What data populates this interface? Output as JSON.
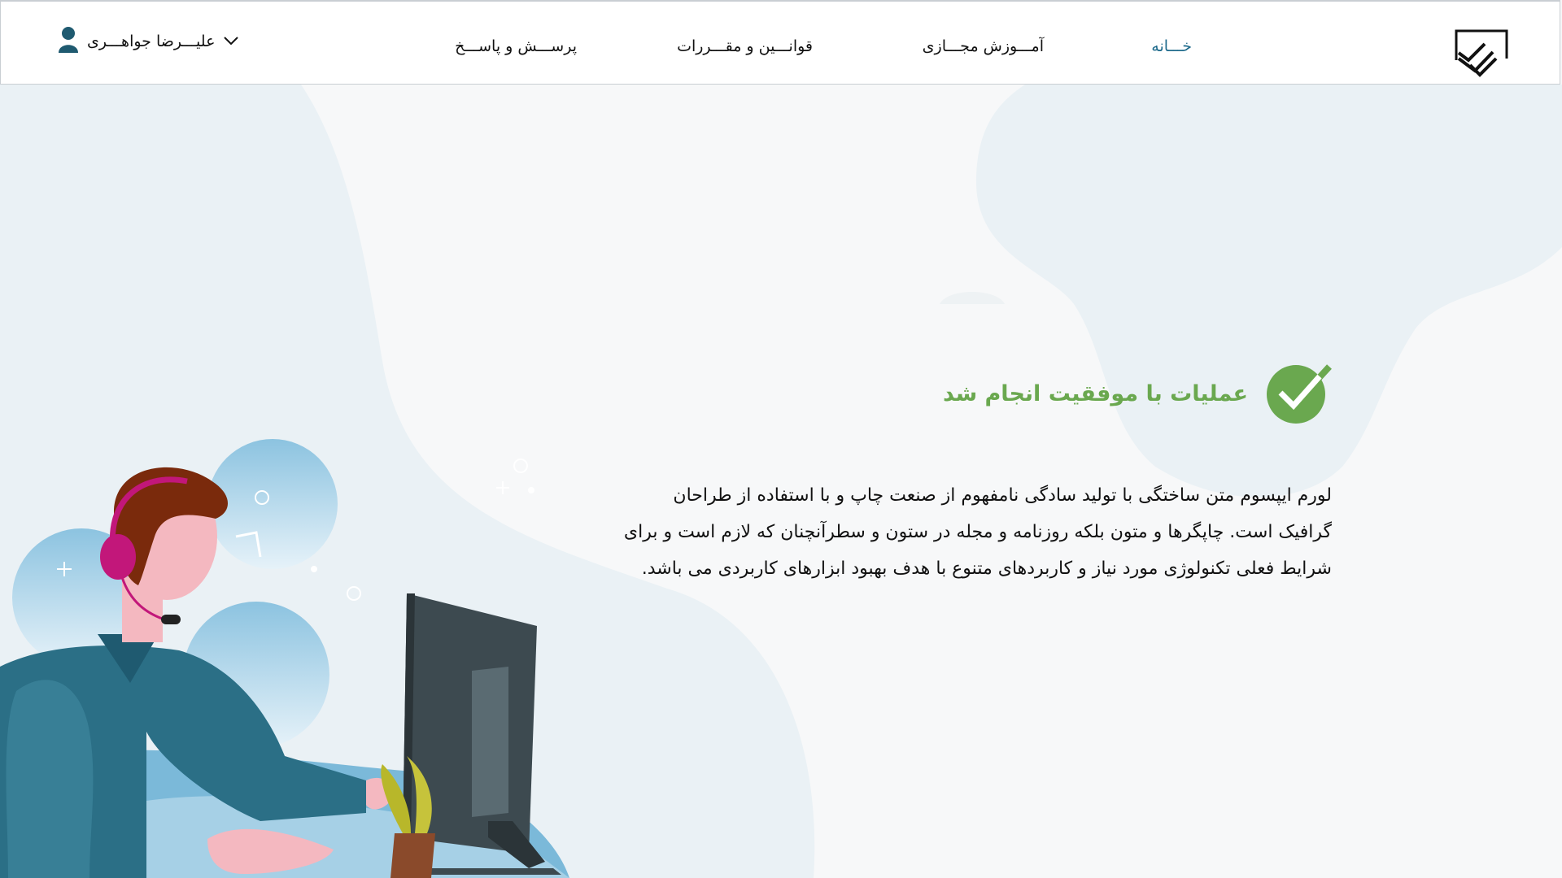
{
  "nav": {
    "home": "خـــانه",
    "virtual_education": "آمـــوزش مجـــازی",
    "rules": "قوانـــین و مقـــررات",
    "faq": "پرســـش و پاســـخ"
  },
  "user": {
    "name": "علیـــرضا جواهـــری",
    "icon": "user-icon",
    "dropdown_icon": "chevron-down-icon"
  },
  "success": {
    "title": "عملیات با موفقیت انجام شد",
    "icon": "check-circle-icon",
    "description": "لورم ایپسوم متن ساختگی با تولید سادگی نامفهوم از صنعت چاپ و با استفاده از طراحان گرافیک است. چاپگرها و متون بلکه روزنامه و مجله در ستون و سطرآنچنان که لازم است و برای شرایط فعلی تکنولوژی مورد نیاز و کاربردهای متنوع با هدف بهبود ابزارهای کاربردی می باشد."
  },
  "colors": {
    "accent": "#1f6b8c",
    "success": "#6aa84f",
    "shirt": "#2b6f86",
    "monitor": "#3d4a50"
  }
}
